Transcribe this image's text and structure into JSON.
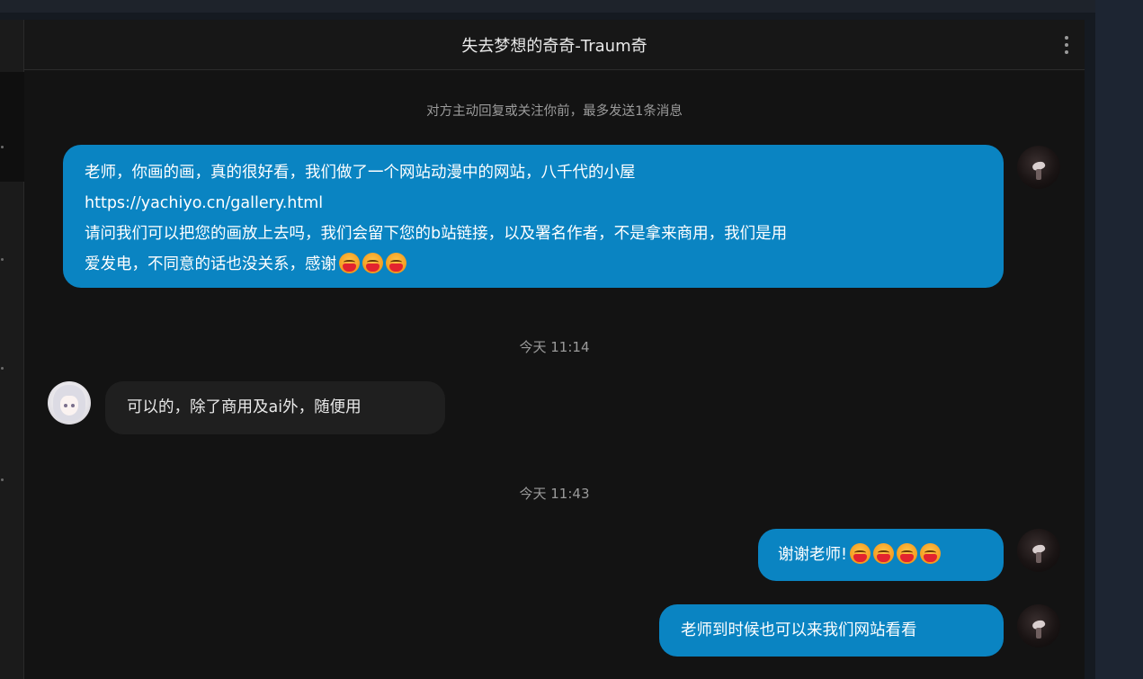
{
  "chat": {
    "title": "失去梦想的奇奇-Traum奇",
    "notice": "对方主动回复或关注你前，最多发送1条消息",
    "messages": [
      {
        "lines": [
          "老师，你画的画，真的很好看，我们做了一个网站动漫中的网站，八千代的小屋",
          "https://yachiyo.cn/gallery.html",
          "请问我们可以把您的画放上去吗，我们会留下您的b站链接，以及署名作者，不是拿来商用，我们是用",
          "爱发电，不同意的话也没关系，感谢"
        ],
        "emoji_name": "face-with-mask-emoji"
      },
      {
        "timestamp": "今天 11:14"
      },
      {
        "text": "可以的，除了商用及ai外，随便用"
      },
      {
        "timestamp": "今天 11:43"
      },
      {
        "text": "谢谢老师!",
        "emoji_name": "face-with-mask-emoji"
      },
      {
        "text": "老师到时候也可以来我们网站看看"
      }
    ]
  },
  "colors": {
    "outgoing_bubble": "#0a84c2",
    "incoming_bubble": "#1f1f1f",
    "chat_background": "#131313"
  }
}
